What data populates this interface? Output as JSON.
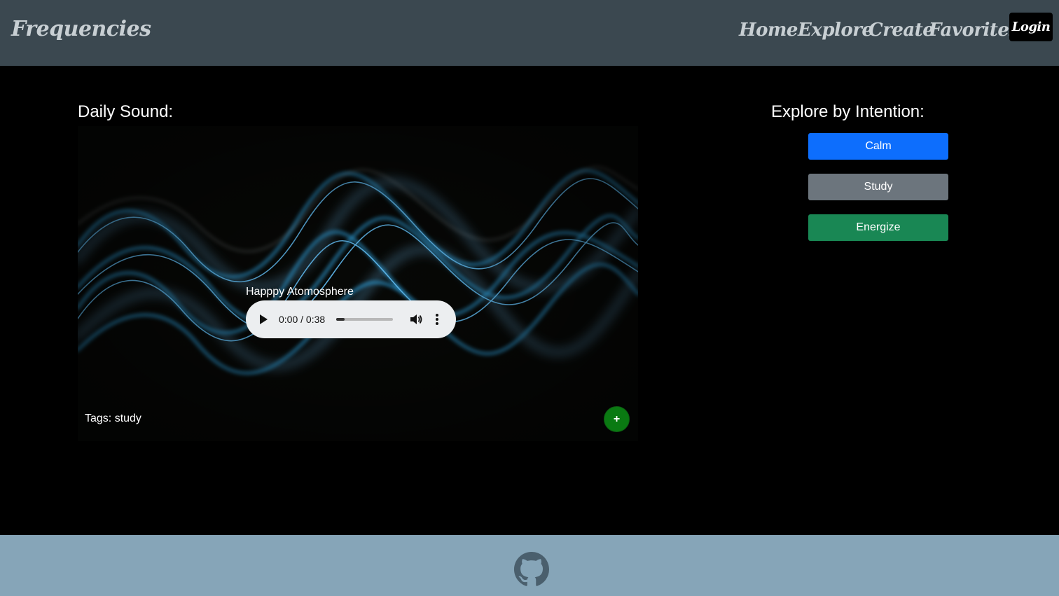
{
  "header": {
    "brand": "Frequencies",
    "nav": [
      "Home",
      "Explore",
      "Create",
      "Favorites"
    ],
    "login_label": "Login"
  },
  "daily_sound": {
    "heading": "Daily Sound:",
    "track_title": "Happpy Atomosphere",
    "time": "0:00 / 0:38",
    "progress_fraction": 0.0,
    "tags": "Tags: study",
    "add_label": "+"
  },
  "explore": {
    "heading": "Explore by Intention:",
    "buttons": [
      {
        "label": "Calm",
        "color": "#0d6efd"
      },
      {
        "label": "Study",
        "color": "#6c757d"
      },
      {
        "label": "Energize",
        "color": "#198754"
      }
    ]
  },
  "footer": {
    "icon": "github-icon"
  }
}
